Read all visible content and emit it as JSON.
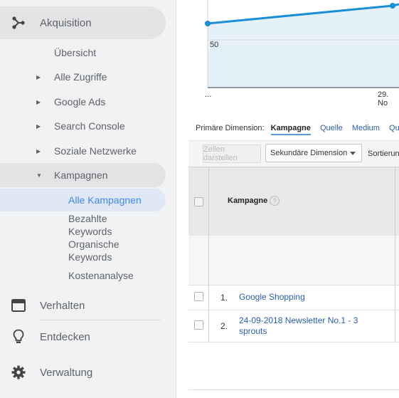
{
  "sidebar": {
    "acquisition": "Akquisition",
    "overview": "Übersicht",
    "all_traffic": "Alle Zugriffe",
    "google_ads": "Google Ads",
    "search_console": "Search Console",
    "social": "Soziale Netzwerke",
    "campaigns": "Kampagnen",
    "all_campaigns": "Alle Kampagnen",
    "paid_keywords_1": "Bezahlte",
    "paid_keywords_2": "Keywords",
    "organic_keywords_1": "Organische",
    "organic_keywords_2": "Keywords",
    "cost_analysis": "Kostenanalyse",
    "behavior": "Verhalten",
    "discover": "Entdecken",
    "admin": "Verwaltung"
  },
  "chart": {
    "y_tick": "50",
    "x_left": "...",
    "x_right": "29. No",
    "line_color": "#1a8fd6"
  },
  "dimension": {
    "label": "Primäre Dimension:",
    "selected": "Kampagne",
    "links": [
      "Quelle",
      "Medium",
      "Qu"
    ]
  },
  "toolbar": {
    "show_rows": "Zellen darstellen",
    "secondary_dimension": "Sekundäre Dimension",
    "sort": "Sortierun"
  },
  "table": {
    "header": "Kampagne",
    "help": "?",
    "rows": [
      {
        "num": "1.",
        "name": "Google Shopping"
      },
      {
        "num": "2.",
        "name": "24-09-2018 Newsletter No.1 - 3 sprouts"
      }
    ]
  }
}
